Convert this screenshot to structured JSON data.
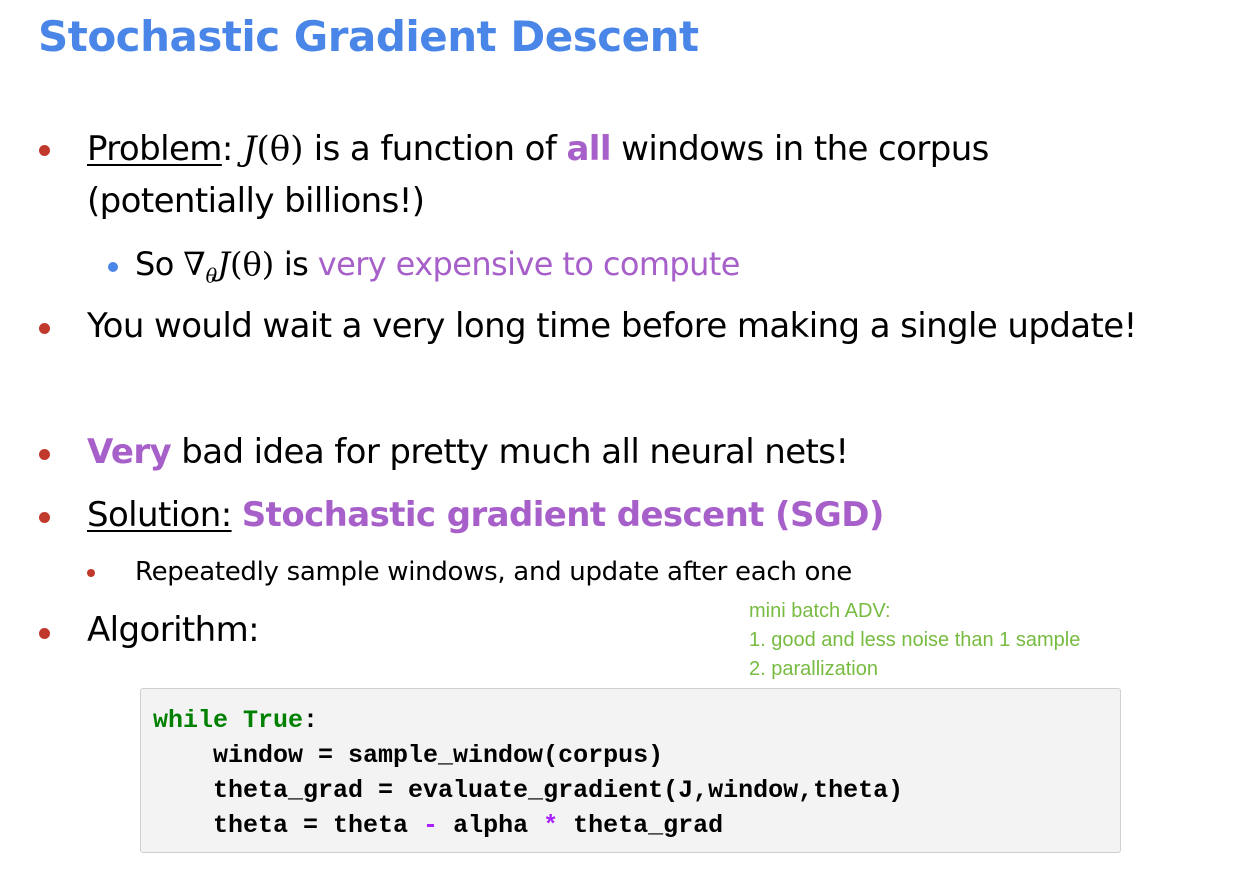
{
  "title": "Stochastic Gradient Descent",
  "bullets": {
    "problem": {
      "label": "Problem",
      "colon": ":",
      "math_J": "J",
      "math_theta": "(θ)",
      "text1": "is a function of",
      "emph": "all",
      "text2": "windows in the corpus",
      "line2": "(potentially billions!)"
    },
    "sub_so": {
      "prefix": "So",
      "math_nabla": "∇",
      "math_sub": "θ",
      "math_J": "J",
      "math_theta": "(θ)",
      "text": "is",
      "emph": "very expensive to compute"
    },
    "wait": "You would wait a very long time before making a single update!",
    "very": {
      "emph": "Very",
      "text": "bad idea for pretty much all neural nets!"
    },
    "solution": {
      "label": "Solution:",
      "emph": "Stochastic gradient descent (SGD)"
    },
    "repeat": "Repeatedly sample windows, and update after each one",
    "algorithm": "Algorithm:"
  },
  "note": {
    "line1": "mini batch ADV:",
    "line2": "1. good and less noise than 1 sample",
    "line3": "2. parallization"
  },
  "code": {
    "l1_kw1": "while",
    "l1_kw2": "True",
    "l1_colon": ":",
    "l2": "    window = sample_window(corpus)",
    "l3": "    theta_grad = evaluate_gradient(J,window,theta)",
    "l4_a": "    theta = theta ",
    "l4_minus": "-",
    "l4_b": " alpha ",
    "l4_star": "*",
    "l4_c": " theta_grad"
  },
  "colors": {
    "title": "#4a86e8",
    "bullet_red": "#c0392b",
    "bullet_blue": "#4a86e8",
    "emphasis_purple": "#a75fc9",
    "note_green": "#77bb41",
    "code_keyword": "#008000",
    "code_operator": "#aa22ff"
  }
}
